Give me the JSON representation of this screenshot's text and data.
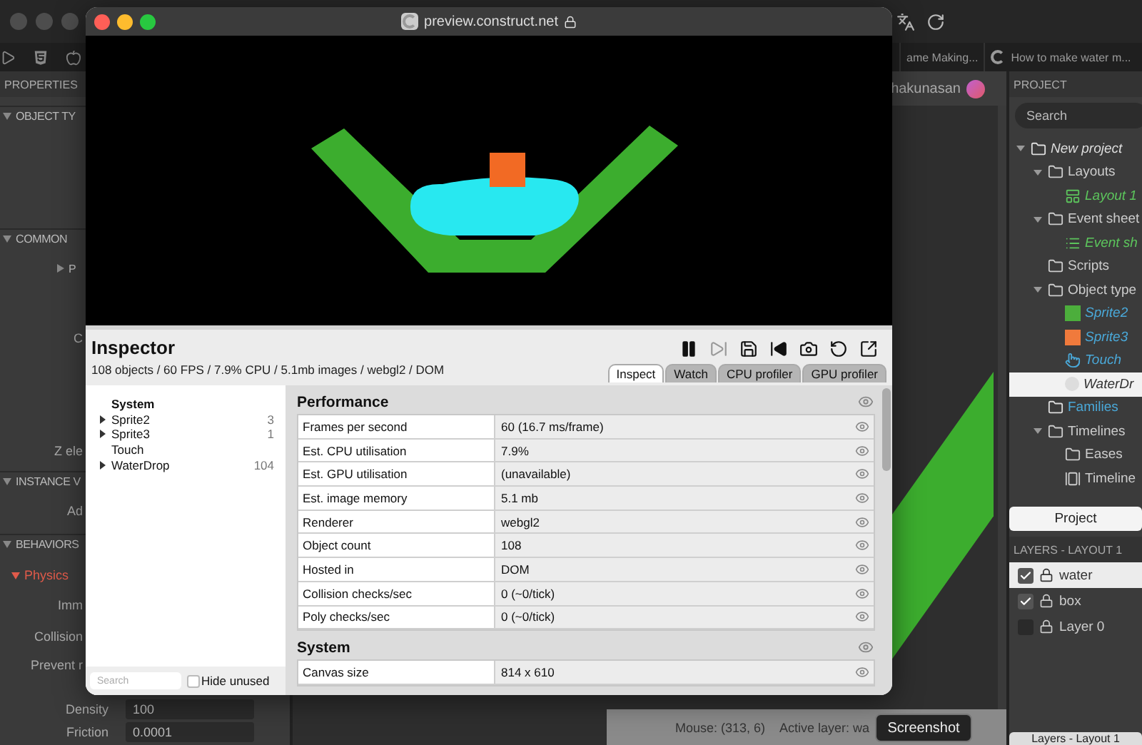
{
  "browser": {
    "tabs": [
      {
        "title": "ame Making..."
      },
      {
        "title": "How to make water m..."
      }
    ]
  },
  "properties": {
    "title": "PROPERTIES",
    "rows": [
      {
        "kind": "section",
        "label": "OBJECT TY",
        "expanded": true
      },
      {
        "kind": "section",
        "label": "COMMON",
        "expanded": true
      },
      {
        "kind": "group",
        "label": "P",
        "expanded": false
      },
      {
        "kind": "prop",
        "label": "C"
      },
      {
        "kind": "prop",
        "label": "Z ele"
      },
      {
        "kind": "section",
        "label": "INSTANCE V",
        "expanded": true
      },
      {
        "kind": "prop",
        "label": "Ad"
      },
      {
        "kind": "section",
        "label": "BEHAVIORS",
        "expanded": true
      },
      {
        "kind": "behavior",
        "label": "Physics",
        "expanded": true
      },
      {
        "kind": "prop",
        "label": "Imm"
      },
      {
        "kind": "prop",
        "label": "Collision"
      },
      {
        "kind": "prop",
        "label": "Prevent r"
      },
      {
        "kind": "field",
        "label": "Density",
        "value": "100"
      },
      {
        "kind": "field",
        "label": "Friction",
        "value": "0.0001"
      }
    ]
  },
  "layout_view": {
    "user": "hakunasan",
    "mouse": "Mouse: (313, 6)",
    "active_layer": "Active layer: wa",
    "tooltip": "Screenshot"
  },
  "preview": {
    "url": "preview.construct.net",
    "inspector": {
      "title": "Inspector",
      "summary": "108 objects / 60 FPS / 7.9% CPU / 5.1mb images / webgl2 / DOM",
      "toolbar": [
        {
          "kind": "pause",
          "disabled": false
        },
        {
          "kind": "step",
          "disabled": true
        },
        {
          "kind": "save",
          "disabled": false
        },
        {
          "kind": "rewind",
          "disabled": false
        },
        {
          "kind": "camera",
          "disabled": false
        },
        {
          "kind": "restart",
          "disabled": false
        },
        {
          "kind": "popout",
          "disabled": false
        }
      ],
      "tabs": [
        {
          "label": "Inspect",
          "selected": true
        },
        {
          "label": "Watch",
          "selected": false
        },
        {
          "label": "CPU profiler",
          "selected": false
        },
        {
          "label": "GPU profiler",
          "selected": false
        }
      ],
      "objects": [
        {
          "kind": "header",
          "name": "System",
          "collapsible": false
        },
        {
          "kind": "object",
          "name": "Sprite2",
          "count": "3",
          "collapsible": true
        },
        {
          "kind": "object",
          "name": "Sprite3",
          "count": "1",
          "collapsible": true
        },
        {
          "kind": "object",
          "name": "Touch",
          "collapsible": false
        },
        {
          "kind": "object",
          "name": "WaterDrop",
          "count": "104",
          "collapsible": true
        }
      ],
      "search": {
        "placeholder": "Search"
      },
      "hide_unused": {
        "label": "Hide unused",
        "checked": false
      },
      "sections": [
        {
          "title": "Performance",
          "rows": [
            {
              "label": "Frames per second",
              "value": "60 (16.7 ms/frame)"
            },
            {
              "label": "Est. CPU utilisation",
              "value": "7.9%"
            },
            {
              "label": "Est. GPU utilisation",
              "value": "(unavailable)"
            },
            {
              "label": "Est. image memory",
              "value": "5.1 mb"
            },
            {
              "label": "Renderer",
              "value": "webgl2"
            },
            {
              "label": "Object count",
              "value": "108"
            },
            {
              "label": "Hosted in",
              "value": "DOM"
            },
            {
              "label": "Collision checks/sec",
              "value": "0 (~0/tick)"
            },
            {
              "label": "Poly checks/sec",
              "value": "0 (~0/tick)"
            }
          ]
        },
        {
          "title": "System",
          "rows": [
            {
              "label": "Canvas size",
              "value": "814 x 610"
            }
          ]
        }
      ]
    }
  },
  "project": {
    "title": "PROJECT",
    "search": {
      "placeholder": "Search"
    },
    "tree": [
      {
        "kind": "root",
        "label": "New project",
        "expanded": true,
        "selected": false,
        "children": [
          {
            "kind": "folder",
            "label": "Layouts",
            "expanded": true,
            "selected": false,
            "children": [
              {
                "kind": "layout",
                "label": "Layout 1",
                "selected": false
              }
            ]
          },
          {
            "kind": "folder",
            "label": "Event sheet",
            "expanded": true,
            "selected": false,
            "children": [
              {
                "kind": "eventsheet",
                "label": "Event sh",
                "selected": false
              }
            ]
          },
          {
            "kind": "folder",
            "label": "Scripts",
            "selected": false
          },
          {
            "kind": "folder",
            "label": "Object type",
            "expanded": true,
            "selected": false,
            "children": [
              {
                "kind": "sprite",
                "label": "Sprite2",
                "color": "#4cae3c",
                "selected": false
              },
              {
                "kind": "sprite",
                "label": "Sprite3",
                "color": "#f07a3c",
                "selected": false
              },
              {
                "kind": "touch",
                "label": "Touch",
                "selected": false
              },
              {
                "kind": "drop",
                "label": "WaterDr",
                "selected": true
              }
            ]
          },
          {
            "kind": "families",
            "label": "Families",
            "selected": false
          },
          {
            "kind": "folder",
            "label": "Timelines",
            "expanded": true,
            "selected": false,
            "children": [
              {
                "kind": "folder",
                "label": "Eases",
                "selected": false
              },
              {
                "kind": "timeline",
                "label": "Timeline",
                "selected": false
              }
            ]
          }
        ]
      }
    ],
    "tab": {
      "label": "Project",
      "selected": true
    }
  },
  "layers": {
    "title": "LAYERS - LAYOUT 1",
    "items": [
      {
        "name": "water",
        "checked": true,
        "selected": true
      },
      {
        "name": "box",
        "checked": true,
        "selected": false
      },
      {
        "name": "Layer 0",
        "checked": false,
        "selected": false
      }
    ],
    "tab": {
      "label": "Layers - Layout 1",
      "selected": false
    }
  }
}
